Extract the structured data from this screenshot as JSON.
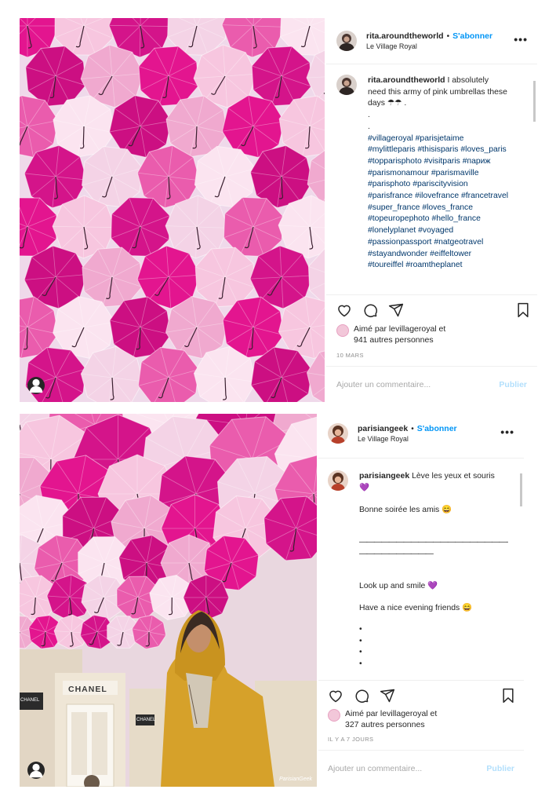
{
  "posts": [
    {
      "username": "rita.aroundtheworld",
      "follow": "S'abonner",
      "separator": "•",
      "location": "Le Village Royal",
      "caption_user": "rita.aroundtheworld",
      "caption_text": "I absolutely need this army of pink umbrellas these days ☂☂ .",
      "caption_dots": [
        ".",
        "."
      ],
      "hashtags": "#villageroyal #parisjetaime #mylittleparis #thisisparis #loves_paris #topparisphoto #visitparis #париж #parismonamour #parismaville #parisphoto #pariscityvision #parisfrance #ilovefrance #francetravel #super_france #loves_france #topeuropephoto #hello_france #lonelyplanet #voyaged #passionpassport #natgeotravel #stayandwonder #eiffeltower #toureiffel #roamtheplanet",
      "liked_by": "Aimé par levillageroyal et",
      "liked_count": "941 autres personnes",
      "date": "10 MARS",
      "comment_placeholder": "Ajouter un commentaire...",
      "publish": "Publier"
    },
    {
      "username": "parisiangeek",
      "follow": "S'abonner",
      "separator": "•",
      "location": "Le Village Royal",
      "caption_user": "parisiangeek",
      "caption_line1": "Lève les yeux et souris",
      "caption_emoji1": "💜",
      "caption_line2": "Bonne soirée les amis 😄",
      "caption_rule": "——————————————————————————————",
      "caption_rule2": "——————————",
      "caption_line3": "Look up and smile 💜",
      "caption_line4": "Have a nice evening friends 😄",
      "caption_bullets": [
        "•",
        "•",
        "•",
        "•"
      ],
      "liked_by": "Aimé par levillageroyal et",
      "liked_count": "327 autres personnes",
      "date": "IL Y A 7 JOURS",
      "comment_placeholder": "Ajouter un commentaire...",
      "publish": "Publier",
      "photo_sign": "CHANEL",
      "photo_sign2": "CHANEL",
      "photo_sign3": "CHANEL",
      "photo_watermark": "ParisianGeek"
    }
  ],
  "icons": [
    "heart-icon",
    "comment-icon",
    "share-icon",
    "bookmark-icon",
    "more-icon",
    "person-icon"
  ]
}
